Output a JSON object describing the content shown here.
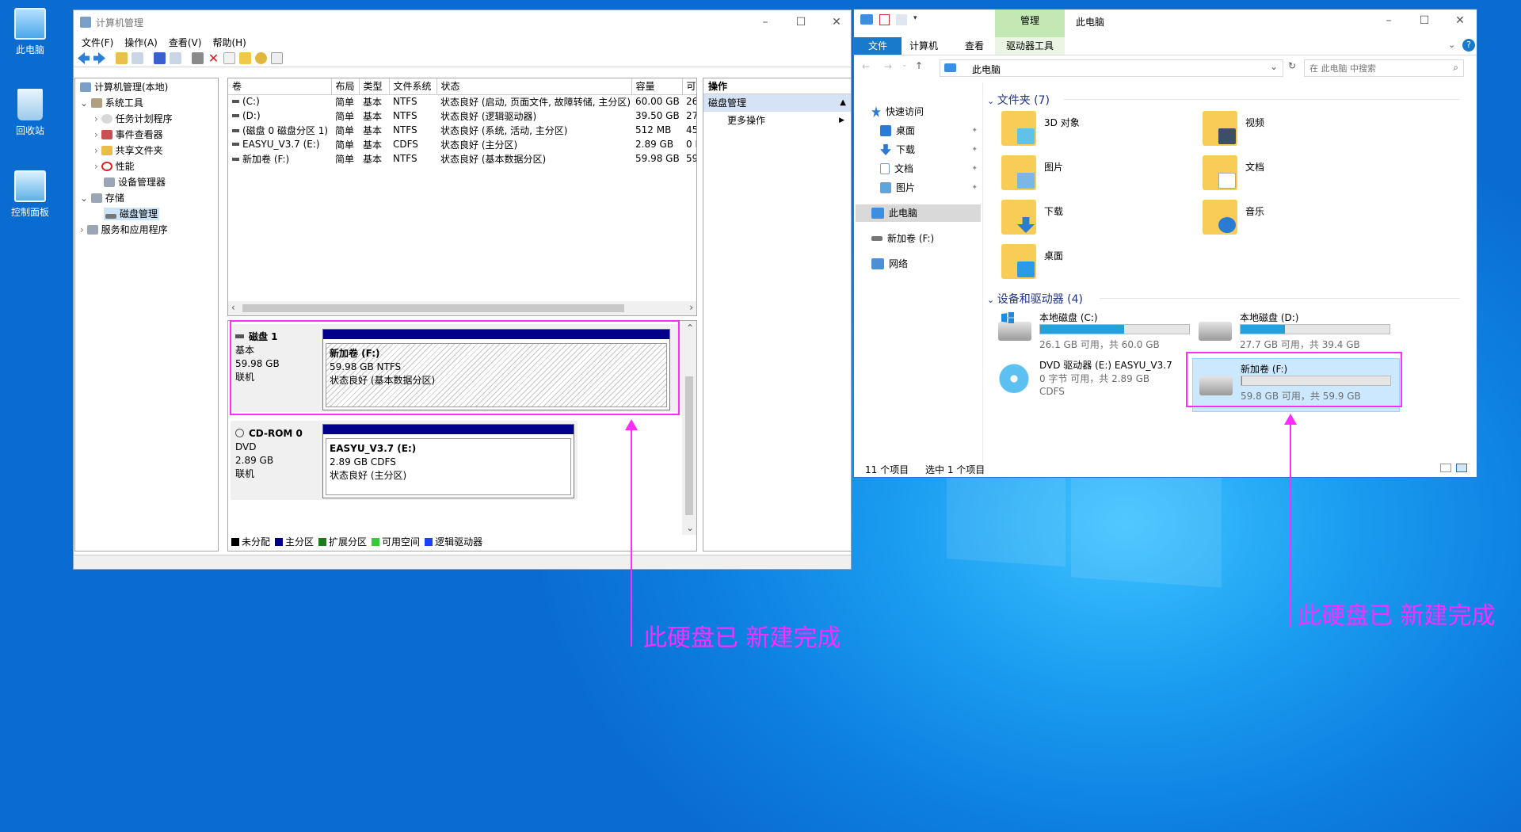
{
  "desktop": {
    "icons": [
      {
        "label": "此电脑"
      },
      {
        "label": "回收站"
      },
      {
        "label": "控制面板"
      }
    ]
  },
  "compmgmt": {
    "title": "计算机管理",
    "menu": [
      "文件(F)",
      "操作(A)",
      "查看(V)",
      "帮助(H)"
    ],
    "tree": [
      {
        "label": "计算机管理(本地)"
      },
      {
        "label": "系统工具"
      },
      {
        "label": "任务计划程序"
      },
      {
        "label": "事件查看器"
      },
      {
        "label": "共享文件夹"
      },
      {
        "label": "性能"
      },
      {
        "label": "设备管理器"
      },
      {
        "label": "存储"
      },
      {
        "label": "磁盘管理"
      },
      {
        "label": "服务和应用程序"
      }
    ],
    "columns": [
      "卷",
      "布局",
      "类型",
      "文件系统",
      "状态",
      "容量",
      "可"
    ],
    "volumes": [
      {
        "name": "(C:)",
        "layout": "简单",
        "type": "基本",
        "fs": "NTFS",
        "status": "状态良好 (启动, 页面文件, 故障转储, 主分区)",
        "capacity": "60.00 GB",
        "free": "26"
      },
      {
        "name": "(D:)",
        "layout": "简单",
        "type": "基本",
        "fs": "NTFS",
        "status": "状态良好 (逻辑驱动器)",
        "capacity": "39.50 GB",
        "free": "27"
      },
      {
        "name": "(磁盘 0 磁盘分区 1)",
        "layout": "简单",
        "type": "基本",
        "fs": "NTFS",
        "status": "状态良好 (系统, 活动, 主分区)",
        "capacity": "512 MB",
        "free": "45"
      },
      {
        "name": "EASYU_V3.7 (E:)",
        "layout": "简单",
        "type": "基本",
        "fs": "CDFS",
        "status": "状态良好 (主分区)",
        "capacity": "2.89 GB",
        "free": "0 I"
      },
      {
        "name": "新加卷 (F:)",
        "layout": "简单",
        "type": "基本",
        "fs": "NTFS",
        "status": "状态良好 (基本数据分区)",
        "capacity": "59.98 GB",
        "free": "59"
      }
    ],
    "disk1": {
      "name": "磁盘 1",
      "type": "基本",
      "size": "59.98 GB",
      "state": "联机",
      "part_name": "新加卷  (F:)",
      "part_size": "59.98 GB NTFS",
      "part_status": "状态良好 (基本数据分区)"
    },
    "cdrom": {
      "name": "CD-ROM 0",
      "type": "DVD",
      "size": "2.89 GB",
      "state": "联机",
      "part_name": "EASYU_V3.7  (E:)",
      "part_size": "2.89 GB CDFS",
      "part_status": "状态良好 (主分区)"
    },
    "legend": [
      {
        "label": "未分配",
        "color": "#000000"
      },
      {
        "label": "主分区",
        "color": "#00008b"
      },
      {
        "label": "扩展分区",
        "color": "#1c7c1c"
      },
      {
        "label": "可用空间",
        "color": "#33cc33"
      },
      {
        "label": "逻辑驱动器",
        "color": "#1f3fff"
      }
    ],
    "actions": {
      "header": "操作",
      "section": "磁盘管理",
      "more": "更多操作"
    }
  },
  "explorer": {
    "title": "此电脑",
    "ribbon_context": "管理",
    "tabs": [
      "文件",
      "计算机",
      "查看",
      "驱动器工具"
    ],
    "address": "此电脑",
    "search_placeholder": "在 此电脑 中搜索",
    "nav": [
      "快速访问",
      "桌面",
      "下载",
      "文档",
      "图片",
      "此电脑",
      "新加卷 (F:)",
      "网络"
    ],
    "folders_header": "文件夹 (7)",
    "folders": [
      "3D 对象",
      "视频",
      "图片",
      "文档",
      "下载",
      "音乐",
      "桌面"
    ],
    "drives_header": "设备和驱动器 (4)",
    "drives": [
      {
        "name": "本地磁盘 (C:)",
        "space": "26.1 GB 可用，共 60.0 GB",
        "used_fraction": 0.565
      },
      {
        "name": "本地磁盘 (D:)",
        "space": "27.7 GB 可用，共 39.4 GB",
        "used_fraction": 0.297
      },
      {
        "name": "DVD 驱动器 (E:) EASYU_V3.7",
        "space": "0 字节 可用，共 2.89 GB",
        "fs": "CDFS"
      },
      {
        "name": "新加卷 (F:)",
        "space": "59.8 GB 可用，共 59.9 GB",
        "used_fraction": 0.002
      }
    ],
    "status_count": "11 个项目",
    "status_selected": "选中 1 个项目"
  },
  "annotations": [
    "此硬盘已 新建完成",
    "此硬盘已 新建完成"
  ],
  "colors": {
    "annotation": "#ff2cff",
    "partition_header": "#00008b",
    "ribbon_accent": "#1979ca",
    "drive_bar": "#26a0da"
  }
}
